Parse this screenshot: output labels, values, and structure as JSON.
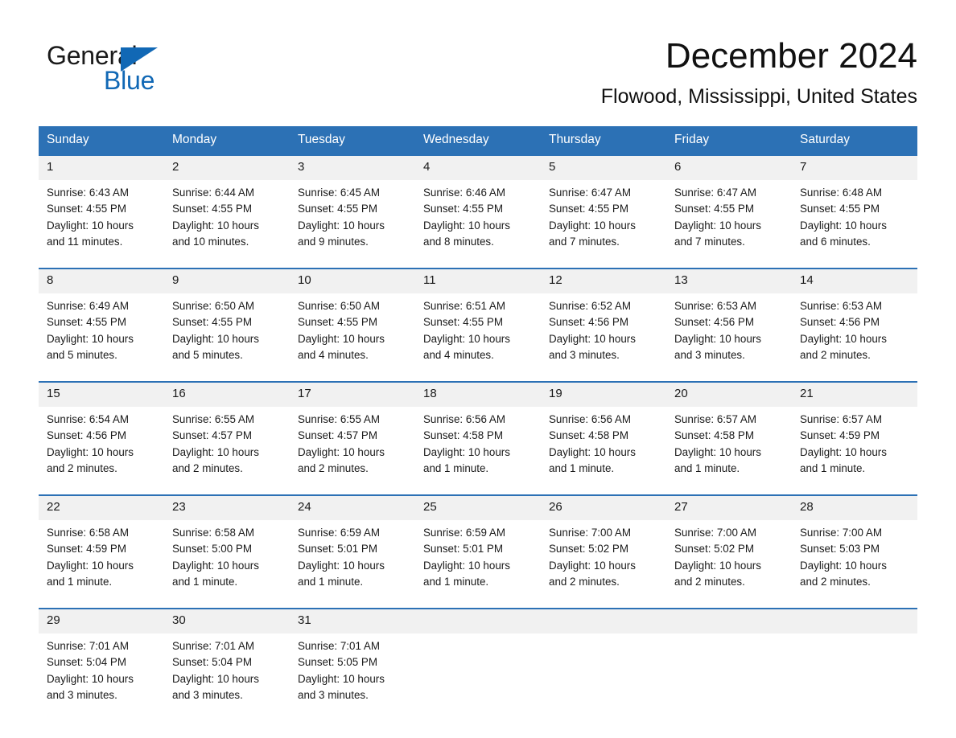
{
  "brand": {
    "word1": "General",
    "word2": "Blue",
    "accent_color": "#1168b5",
    "triangle_icon": "triangle-icon"
  },
  "header": {
    "title": "December 2024",
    "location": "Flowood, Mississippi, United States"
  },
  "calendar": {
    "header_bg": "#2c71b5",
    "header_text_color": "#ffffff",
    "daynum_bg": "#f1f1f1",
    "weekdays": [
      "Sunday",
      "Monday",
      "Tuesday",
      "Wednesday",
      "Thursday",
      "Friday",
      "Saturday"
    ],
    "labels": {
      "sunrise": "Sunrise:",
      "sunset": "Sunset:",
      "daylight": "Daylight:"
    },
    "weeks": [
      {
        "days": [
          {
            "num": "1",
            "sunrise": "Sunrise: 6:43 AM",
            "sunset": "Sunset: 4:55 PM",
            "daylight_1": "Daylight: 10 hours",
            "daylight_2": "and 11 minutes."
          },
          {
            "num": "2",
            "sunrise": "Sunrise: 6:44 AM",
            "sunset": "Sunset: 4:55 PM",
            "daylight_1": "Daylight: 10 hours",
            "daylight_2": "and 10 minutes."
          },
          {
            "num": "3",
            "sunrise": "Sunrise: 6:45 AM",
            "sunset": "Sunset: 4:55 PM",
            "daylight_1": "Daylight: 10 hours",
            "daylight_2": "and 9 minutes."
          },
          {
            "num": "4",
            "sunrise": "Sunrise: 6:46 AM",
            "sunset": "Sunset: 4:55 PM",
            "daylight_1": "Daylight: 10 hours",
            "daylight_2": "and 8 minutes."
          },
          {
            "num": "5",
            "sunrise": "Sunrise: 6:47 AM",
            "sunset": "Sunset: 4:55 PM",
            "daylight_1": "Daylight: 10 hours",
            "daylight_2": "and 7 minutes."
          },
          {
            "num": "6",
            "sunrise": "Sunrise: 6:47 AM",
            "sunset": "Sunset: 4:55 PM",
            "daylight_1": "Daylight: 10 hours",
            "daylight_2": "and 7 minutes."
          },
          {
            "num": "7",
            "sunrise": "Sunrise: 6:48 AM",
            "sunset": "Sunset: 4:55 PM",
            "daylight_1": "Daylight: 10 hours",
            "daylight_2": "and 6 minutes."
          }
        ]
      },
      {
        "days": [
          {
            "num": "8",
            "sunrise": "Sunrise: 6:49 AM",
            "sunset": "Sunset: 4:55 PM",
            "daylight_1": "Daylight: 10 hours",
            "daylight_2": "and 5 minutes."
          },
          {
            "num": "9",
            "sunrise": "Sunrise: 6:50 AM",
            "sunset": "Sunset: 4:55 PM",
            "daylight_1": "Daylight: 10 hours",
            "daylight_2": "and 5 minutes."
          },
          {
            "num": "10",
            "sunrise": "Sunrise: 6:50 AM",
            "sunset": "Sunset: 4:55 PM",
            "daylight_1": "Daylight: 10 hours",
            "daylight_2": "and 4 minutes."
          },
          {
            "num": "11",
            "sunrise": "Sunrise: 6:51 AM",
            "sunset": "Sunset: 4:55 PM",
            "daylight_1": "Daylight: 10 hours",
            "daylight_2": "and 4 minutes."
          },
          {
            "num": "12",
            "sunrise": "Sunrise: 6:52 AM",
            "sunset": "Sunset: 4:56 PM",
            "daylight_1": "Daylight: 10 hours",
            "daylight_2": "and 3 minutes."
          },
          {
            "num": "13",
            "sunrise": "Sunrise: 6:53 AM",
            "sunset": "Sunset: 4:56 PM",
            "daylight_1": "Daylight: 10 hours",
            "daylight_2": "and 3 minutes."
          },
          {
            "num": "14",
            "sunrise": "Sunrise: 6:53 AM",
            "sunset": "Sunset: 4:56 PM",
            "daylight_1": "Daylight: 10 hours",
            "daylight_2": "and 2 minutes."
          }
        ]
      },
      {
        "days": [
          {
            "num": "15",
            "sunrise": "Sunrise: 6:54 AM",
            "sunset": "Sunset: 4:56 PM",
            "daylight_1": "Daylight: 10 hours",
            "daylight_2": "and 2 minutes."
          },
          {
            "num": "16",
            "sunrise": "Sunrise: 6:55 AM",
            "sunset": "Sunset: 4:57 PM",
            "daylight_1": "Daylight: 10 hours",
            "daylight_2": "and 2 minutes."
          },
          {
            "num": "17",
            "sunrise": "Sunrise: 6:55 AM",
            "sunset": "Sunset: 4:57 PM",
            "daylight_1": "Daylight: 10 hours",
            "daylight_2": "and 2 minutes."
          },
          {
            "num": "18",
            "sunrise": "Sunrise: 6:56 AM",
            "sunset": "Sunset: 4:58 PM",
            "daylight_1": "Daylight: 10 hours",
            "daylight_2": "and 1 minute."
          },
          {
            "num": "19",
            "sunrise": "Sunrise: 6:56 AM",
            "sunset": "Sunset: 4:58 PM",
            "daylight_1": "Daylight: 10 hours",
            "daylight_2": "and 1 minute."
          },
          {
            "num": "20",
            "sunrise": "Sunrise: 6:57 AM",
            "sunset": "Sunset: 4:58 PM",
            "daylight_1": "Daylight: 10 hours",
            "daylight_2": "and 1 minute."
          },
          {
            "num": "21",
            "sunrise": "Sunrise: 6:57 AM",
            "sunset": "Sunset: 4:59 PM",
            "daylight_1": "Daylight: 10 hours",
            "daylight_2": "and 1 minute."
          }
        ]
      },
      {
        "days": [
          {
            "num": "22",
            "sunrise": "Sunrise: 6:58 AM",
            "sunset": "Sunset: 4:59 PM",
            "daylight_1": "Daylight: 10 hours",
            "daylight_2": "and 1 minute."
          },
          {
            "num": "23",
            "sunrise": "Sunrise: 6:58 AM",
            "sunset": "Sunset: 5:00 PM",
            "daylight_1": "Daylight: 10 hours",
            "daylight_2": "and 1 minute."
          },
          {
            "num": "24",
            "sunrise": "Sunrise: 6:59 AM",
            "sunset": "Sunset: 5:01 PM",
            "daylight_1": "Daylight: 10 hours",
            "daylight_2": "and 1 minute."
          },
          {
            "num": "25",
            "sunrise": "Sunrise: 6:59 AM",
            "sunset": "Sunset: 5:01 PM",
            "daylight_1": "Daylight: 10 hours",
            "daylight_2": "and 1 minute."
          },
          {
            "num": "26",
            "sunrise": "Sunrise: 7:00 AM",
            "sunset": "Sunset: 5:02 PM",
            "daylight_1": "Daylight: 10 hours",
            "daylight_2": "and 2 minutes."
          },
          {
            "num": "27",
            "sunrise": "Sunrise: 7:00 AM",
            "sunset": "Sunset: 5:02 PM",
            "daylight_1": "Daylight: 10 hours",
            "daylight_2": "and 2 minutes."
          },
          {
            "num": "28",
            "sunrise": "Sunrise: 7:00 AM",
            "sunset": "Sunset: 5:03 PM",
            "daylight_1": "Daylight: 10 hours",
            "daylight_2": "and 2 minutes."
          }
        ]
      },
      {
        "days": [
          {
            "num": "29",
            "sunrise": "Sunrise: 7:01 AM",
            "sunset": "Sunset: 5:04 PM",
            "daylight_1": "Daylight: 10 hours",
            "daylight_2": "and 3 minutes."
          },
          {
            "num": "30",
            "sunrise": "Sunrise: 7:01 AM",
            "sunset": "Sunset: 5:04 PM",
            "daylight_1": "Daylight: 10 hours",
            "daylight_2": "and 3 minutes."
          },
          {
            "num": "31",
            "sunrise": "Sunrise: 7:01 AM",
            "sunset": "Sunset: 5:05 PM",
            "daylight_1": "Daylight: 10 hours",
            "daylight_2": "and 3 minutes."
          },
          {
            "num": "",
            "sunrise": "",
            "sunset": "",
            "daylight_1": "",
            "daylight_2": ""
          },
          {
            "num": "",
            "sunrise": "",
            "sunset": "",
            "daylight_1": "",
            "daylight_2": ""
          },
          {
            "num": "",
            "sunrise": "",
            "sunset": "",
            "daylight_1": "",
            "daylight_2": ""
          },
          {
            "num": "",
            "sunrise": "",
            "sunset": "",
            "daylight_1": "",
            "daylight_2": ""
          }
        ]
      }
    ]
  }
}
